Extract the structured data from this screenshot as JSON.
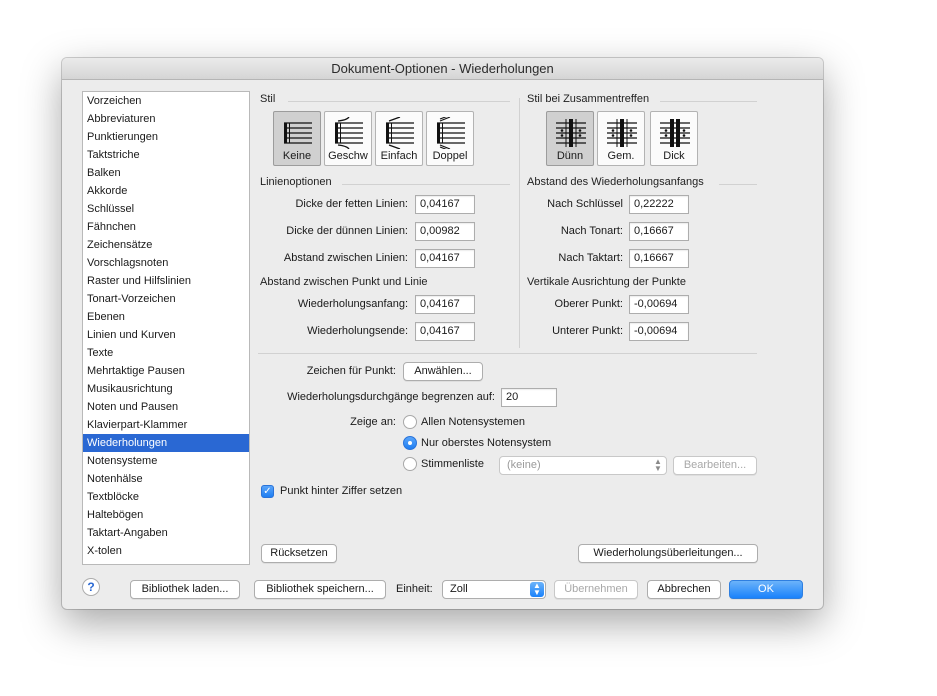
{
  "window": {
    "title": "Dokument-Optionen - Wiederholungen"
  },
  "sidebar": {
    "items": [
      "Vorzeichen",
      "Abbreviaturen",
      "Punktierungen",
      "Taktstriche",
      "Balken",
      "Akkorde",
      "Schlüssel",
      "Fähnchen",
      "Zeichensätze",
      "Vorschlagsnoten",
      "Raster und Hilfslinien",
      "Tonart-Vorzeichen",
      "Ebenen",
      "Linien und Kurven",
      "Texte",
      "Mehrtaktige Pausen",
      "Musikausrichtung",
      "Noten und Pausen",
      "Klavierpart-Klammer",
      "Wiederholungen",
      "Notensysteme",
      "Notenhälse",
      "Textblöcke",
      "Haltebögen",
      "Taktart-Angaben",
      "X-tolen"
    ],
    "selected": "Wiederholungen"
  },
  "stil": {
    "label": "Stil",
    "buttons": [
      "Keine",
      "Geschw",
      "Einfach",
      "Doppel"
    ],
    "active": "Keine"
  },
  "zusammentreffen": {
    "label": "Stil bei Zusammentreffen",
    "buttons": [
      "Dünn",
      "Gem.",
      "Dick"
    ],
    "active": "Dünn"
  },
  "linienoptionen": {
    "label": "Linienoptionen",
    "fett_label": "Dicke der fetten Linien:",
    "fett_value": "0,04167",
    "duenn_label": "Dicke der dünnen Linien:",
    "duenn_value": "0,00982",
    "abstand_label": "Abstand zwischen Linien:",
    "abstand_value": "0,04167"
  },
  "anfang": {
    "label": "Abstand des Wiederholungsanfangs",
    "schluessel_label": "Nach Schlüssel",
    "schluessel_value": "0,22222",
    "tonart_label": "Nach Tonart:",
    "tonart_value": "0,16667",
    "taktart_label": "Nach Taktart:",
    "taktart_value": "0,16667"
  },
  "punkt_linie": {
    "label": "Abstand zwischen Punkt und Linie",
    "anfang_label": "Wiederholungsanfang:",
    "anfang_value": "0,04167",
    "ende_label": "Wiederholungsende:",
    "ende_value": "0,04167"
  },
  "vertikal": {
    "label": "Vertikale Ausrichtung der Punkte",
    "oben_label": "Oberer Punkt:",
    "oben_value": "-0,00694",
    "unten_label": "Unterer Punkt:",
    "unten_value": "-0,00694"
  },
  "zeichen": {
    "label": "Zeichen für Punkt:",
    "button": "Anwählen..."
  },
  "begrenzen": {
    "label": "Wiederholungsdurchgänge begrenzen auf:",
    "value": "20"
  },
  "zeige": {
    "label": "Zeige an:",
    "options": [
      "Allen Notensystemen",
      "Nur oberstes Notensystem",
      "Stimmenliste"
    ],
    "selected": "Nur oberstes Notensystem",
    "stimmen_select": "(keine)",
    "bearbeiten": "Bearbeiten..."
  },
  "punkt_hinter": {
    "label": "Punkt hinter Ziffer setzen",
    "checked": true
  },
  "buttons": {
    "ruecksetzen": "Rücksetzen",
    "ueberleitungen": "Wiederholungsüberleitungen...",
    "help": "?",
    "bibliothek_laden": "Bibliothek laden...",
    "bibliothek_speichern": "Bibliothek speichern...",
    "einheit_label": "Einheit:",
    "einheit_value": "Zoll",
    "uebernehmen": "Übernehmen",
    "abbrechen": "Abbrechen",
    "ok": "OK"
  },
  "colors": {
    "accent": "#2a68d3",
    "ok_button": "#1a82fb",
    "window_bg": "#ececec"
  }
}
